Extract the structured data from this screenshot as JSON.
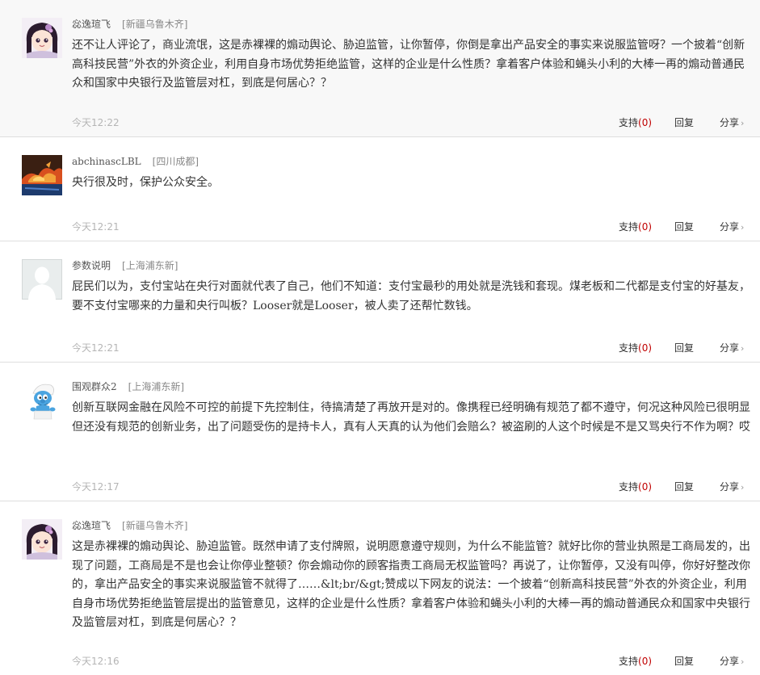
{
  "comments": [
    {
      "username": "惢逸瑄飞",
      "location": "[新疆乌鲁木齐]",
      "avatar_icon": "anime-girl-avatar-icon",
      "text": "还不让人评论了，商业流氓，这是赤裸裸的煽动舆论、胁迫监管，让你暂停，你倒是拿出产品安全的事实来说服监管呀？一个披着“创新高科技民营”外衣的外资企业，利用自身市场优势拒绝监管，这样的企业是什么性质？拿着客户体验和蝇头小利的大棒一再的煽动普通民众和国家中央银行及监管层对杠，到底是何居心？？",
      "time": "今天12:22",
      "support_label": "支持",
      "support_count": "(0)",
      "reply_label": "回复",
      "share_label": "分享",
      "share_arrow": "›"
    },
    {
      "username": "abchinascLBL",
      "location": "[四川成都]",
      "avatar_icon": "fire-horse-avatar-icon",
      "text": "央行很及时，保护公众安全。",
      "time": "今天12:21",
      "support_label": "支持",
      "support_count": "(0)",
      "reply_label": "回复",
      "share_label": "分享",
      "share_arrow": "›"
    },
    {
      "username": "参数说明",
      "location": "[上海浦东新]",
      "avatar_icon": "default-user-avatar-icon",
      "text": "屁民们以为，支付宝站在央行对面就代表了自己，他们不知道：支付宝最秒的用处就是洗钱和套现。煤老板和二代都是支付宝的好基友，要不支付宝哪来的力量和央行叫板？Looser就是Looser，被人卖了还帮忙数钱。",
      "time": "今天12:21",
      "support_label": "支持",
      "support_count": "(0)",
      "reply_label": "回复",
      "share_label": "分享",
      "share_arrow": "›"
    },
    {
      "username": "围观群众2",
      "location": "[上海浦东新]",
      "avatar_icon": "smurf-avatar-icon",
      "text": "创新互联网金融在风险不可控的前提下先控制住，待搞清楚了再放开是对的。像携程已经明确有规范了都不遵守，何况这种风险已很明显但还没有规范的创新业务，出了问题受伤的是持卡人，真有人天真的认为他们会赔么？被盗刷的人这个时候是不是又骂央行不作为啊？哎",
      "time": "今天12:17",
      "support_label": "支持",
      "support_count": "(0)",
      "reply_label": "回复",
      "share_label": "分享",
      "share_arrow": "›"
    },
    {
      "username": "惢逸瑄飞",
      "location": "[新疆乌鲁木齐]",
      "avatar_icon": "anime-girl-avatar-icon",
      "text": "这是赤裸裸的煽动舆论、胁迫监管。既然申请了支付牌照，说明愿意遵守规则，为什么不能监管？就好比你的营业执照是工商局发的，出现了问题，工商局是不是也会让你停业整顿？你会煽动你的顾客指责工商局无权监管吗？再说了，让你暂停，又没有叫停，你好好整改你的，拿出产品安全的事实来说服监管不就得了……&lt;br/&gt;赞成以下网友的说法：一个披着“创新高科技民营”外衣的外资企业，利用自身市场优势拒绝监管层提出的监管意见，这样的企业是什么性质？拿着客户体验和蝇头小利的大棒一再的煽动普通民众和国家中央银行及监管层对杠，到底是何居心？？",
      "time": "今天12:16",
      "support_label": "支持",
      "support_count": "(0)",
      "reply_label": "回复",
      "share_label": "分享",
      "share_arrow": "›"
    }
  ]
}
